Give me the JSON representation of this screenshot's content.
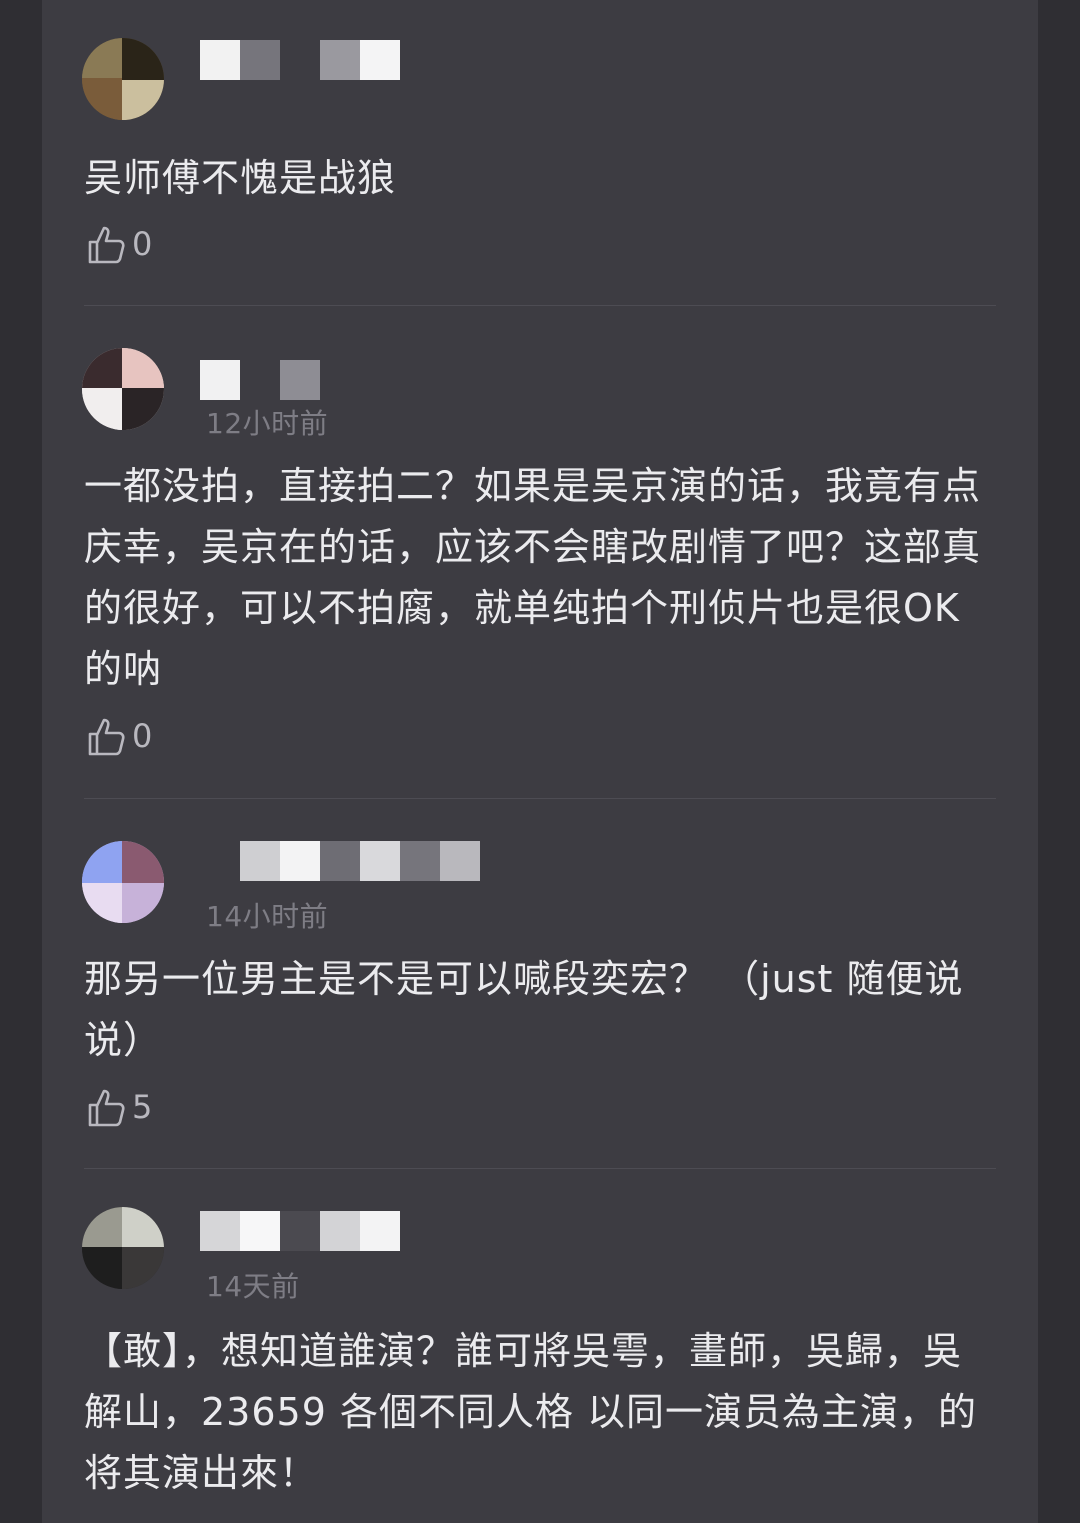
{
  "comments": [
    {
      "time": "",
      "text": "吴师傅不愧是战狼",
      "likes": "0"
    },
    {
      "time": "12小时前",
      "text": "一都没拍，直接拍二？如果是吴京演的话，我竟有点庆幸，吴京在的话，应该不会瞎改剧情了吧？这部真的很好，可以不拍腐，就单纯拍个刑侦片也是很OK的呐",
      "likes": "0"
    },
    {
      "time": "14小时前",
      "text": "那另一位男主是不是可以喊段奕宏？ （just 随便说说）",
      "likes": "5"
    },
    {
      "time": "14天前",
      "text": "【敢】，想知道誰演？誰可將吳雩，畫師，吳歸，吳解山，23659 各個不同人格 以同一演员為主演，的将其演出來！",
      "likes": ""
    }
  ],
  "icons": {
    "like": "thumbs-up-icon"
  },
  "colors": {
    "background": "#3d3c42",
    "text": "#ebebee",
    "meta": "#7e7d85"
  }
}
